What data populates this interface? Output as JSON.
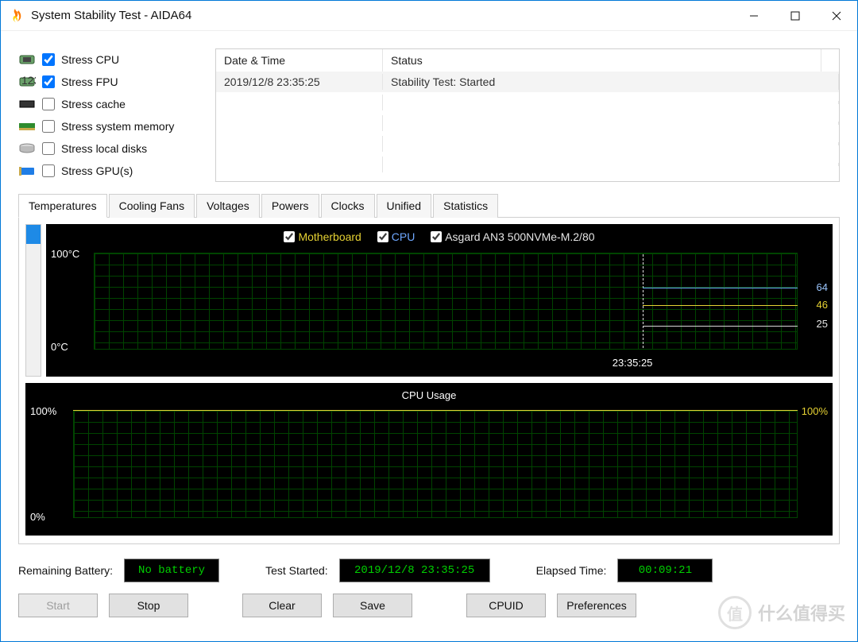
{
  "window": {
    "title": "System Stability Test - AIDA64"
  },
  "stress": {
    "cpu": {
      "label": "Stress CPU",
      "checked": true
    },
    "fpu": {
      "label": "Stress FPU",
      "checked": true
    },
    "cache": {
      "label": "Stress cache",
      "checked": false
    },
    "mem": {
      "label": "Stress system memory",
      "checked": false
    },
    "disks": {
      "label": "Stress local disks",
      "checked": false
    },
    "gpu": {
      "label": "Stress GPU(s)",
      "checked": false
    }
  },
  "log": {
    "headers": {
      "datetime": "Date & Time",
      "status": "Status"
    },
    "rows": [
      {
        "datetime": "2019/12/8 23:35:25",
        "status": "Stability Test: Started"
      }
    ]
  },
  "tabs": {
    "temperatures": "Temperatures",
    "cooling": "Cooling Fans",
    "voltages": "Voltages",
    "powers": "Powers",
    "clocks": "Clocks",
    "unified": "Unified",
    "statistics": "Statistics"
  },
  "temp_chart": {
    "legend": {
      "motherboard": "Motherboard",
      "cpu": "CPU",
      "ssd": "Asgard AN3 500NVMe-M.2/80"
    },
    "axis": {
      "max": "100°C",
      "min": "0°C"
    },
    "value_labels": {
      "cpu": "64",
      "motherboard": "46",
      "ssd": "25"
    },
    "event_time": "23:35:25"
  },
  "usage_chart": {
    "title": "CPU Usage",
    "axis": {
      "max": "100%",
      "min": "0%"
    },
    "current": "100%"
  },
  "status": {
    "battery": {
      "label": "Remaining Battery:",
      "value": "No battery"
    },
    "started": {
      "label": "Test Started:",
      "value": "2019/12/8 23:35:25"
    },
    "elapsed": {
      "label": "Elapsed Time:",
      "value": "00:09:21"
    }
  },
  "buttons": {
    "start": "Start",
    "stop": "Stop",
    "clear": "Clear",
    "save": "Save",
    "cpuid": "CPUID",
    "prefs": "Preferences"
  },
  "chart_data": {
    "temperatures": {
      "type": "line",
      "ylabel": "°C",
      "ylim": [
        0,
        100
      ],
      "event_marker_time": "23:35:25",
      "series": [
        {
          "name": "Motherboard",
          "color": "#e6d233",
          "current_value": 46
        },
        {
          "name": "CPU",
          "color": "#6fa8ff",
          "current_value": 64
        },
        {
          "name": "Asgard AN3 500NVMe-M.2/80",
          "color": "#e6e6e6",
          "current_value": 25
        }
      ]
    },
    "cpu_usage": {
      "type": "line",
      "title": "CPU Usage",
      "ylabel": "%",
      "ylim": [
        0,
        100
      ],
      "current_value": 100,
      "series": [
        {
          "name": "CPU Usage",
          "color": "#e6d233",
          "current_value": 100
        }
      ]
    }
  }
}
